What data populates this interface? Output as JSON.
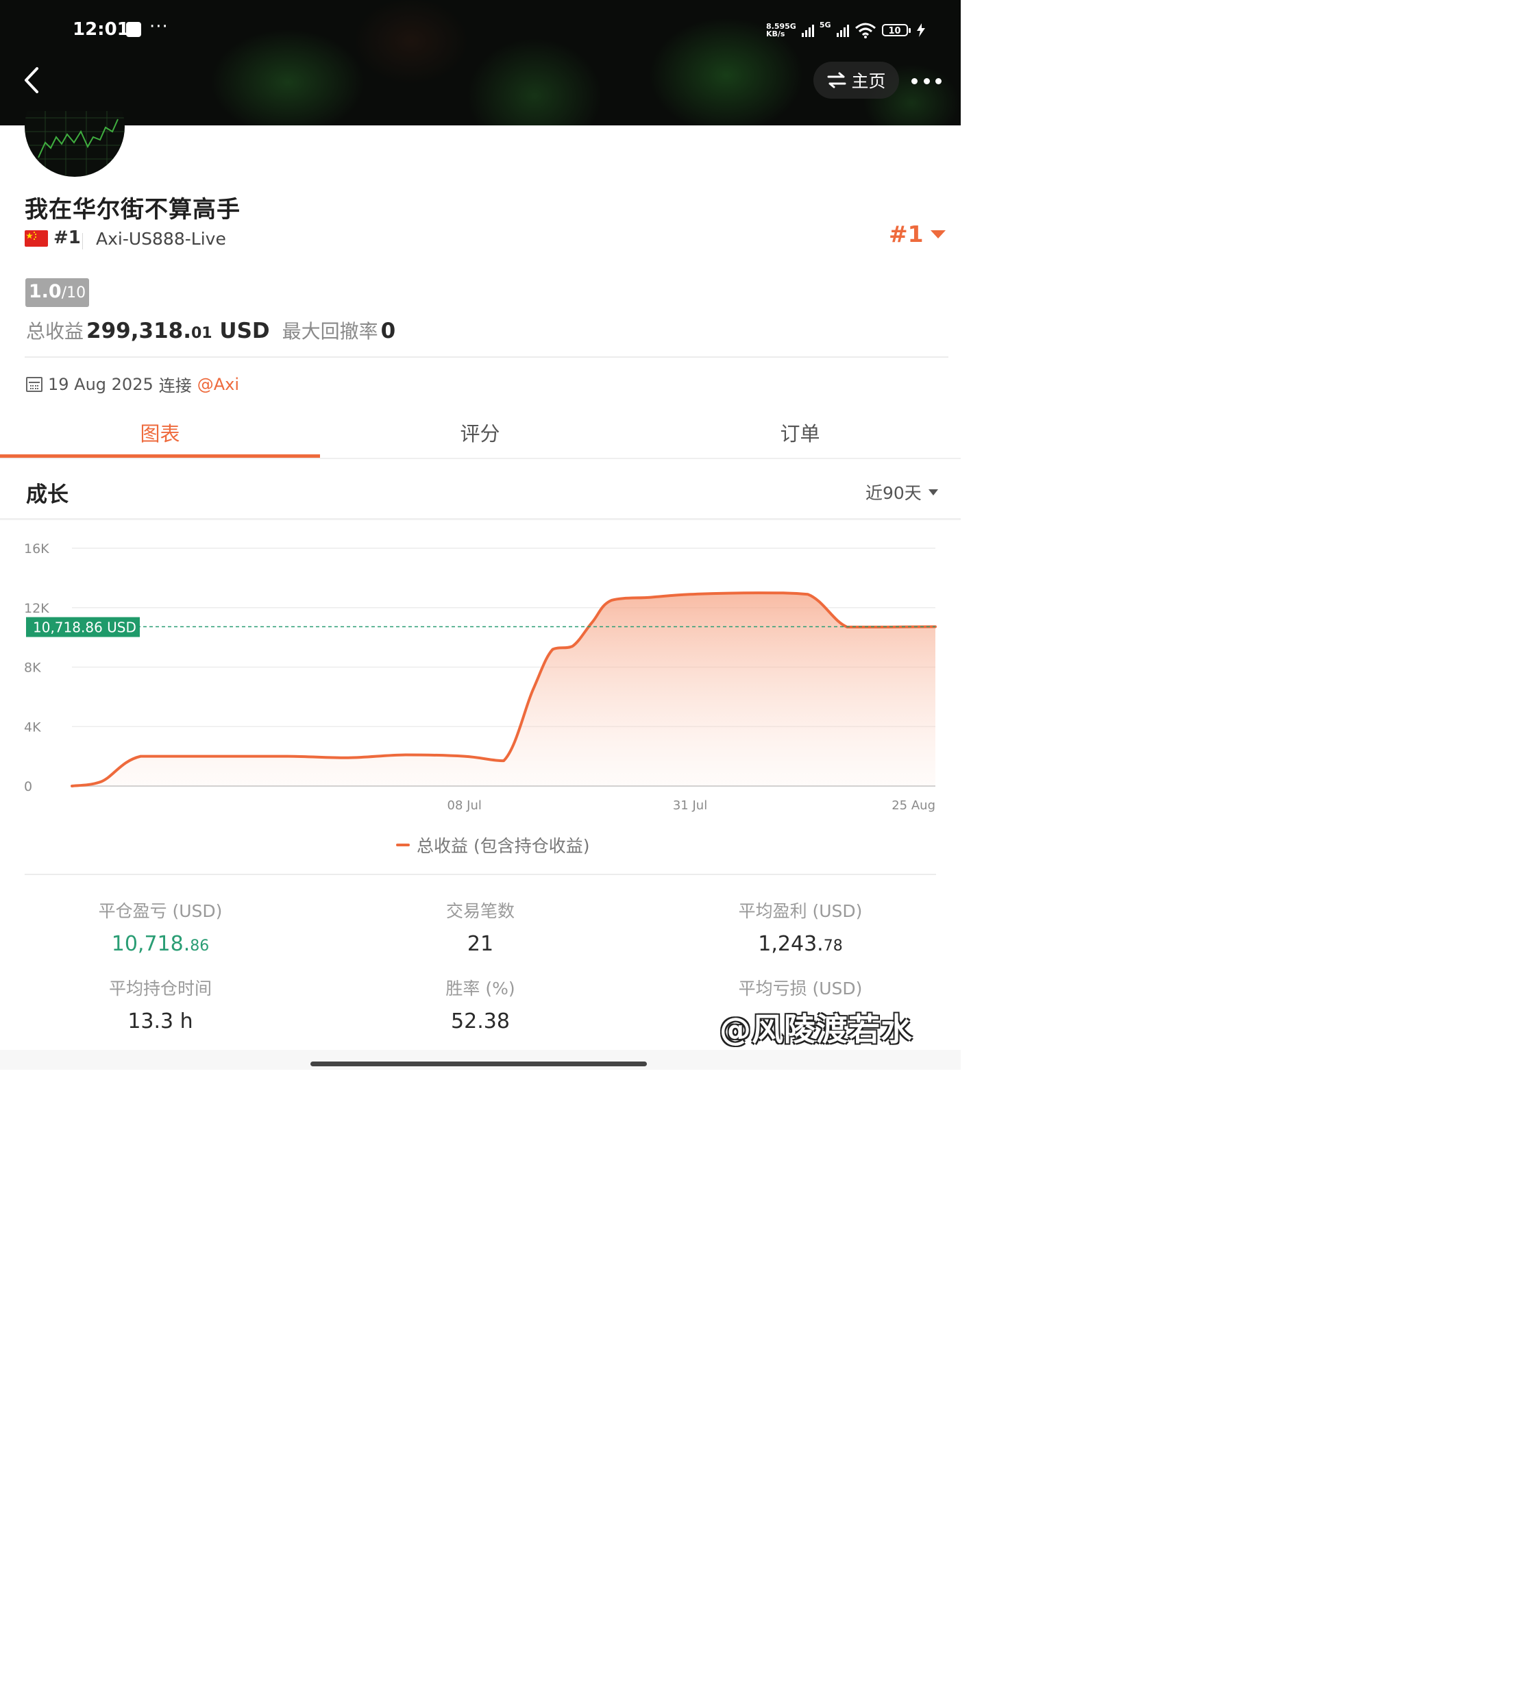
{
  "status_bar": {
    "time": "12:01",
    "net_speed_top": "8.59",
    "net_speed_bottom": "KB/s",
    "net_type_1": "5G",
    "net_type_2": "5G",
    "battery": "10"
  },
  "header": {
    "home_label": "主页"
  },
  "profile": {
    "username": "我在华尔街不算高手",
    "rank_small": "#1",
    "server": "Axi-US888-Live",
    "rank_big": "#1",
    "score": "1.0",
    "score_max": "/10",
    "total_profit_label": "总收益",
    "total_profit_int": "299,318.",
    "total_profit_dec": "01",
    "total_profit_unit": " USD",
    "max_drawdown_label": "最大回撤率",
    "max_drawdown_value": "0",
    "connect_date": "19 Aug 2025",
    "connect_label": "连接",
    "connect_broker": "@Axi"
  },
  "tabs": [
    {
      "label": "图表",
      "active": true
    },
    {
      "label": "评分",
      "active": false
    },
    {
      "label": "订单",
      "active": false
    }
  ],
  "section": {
    "title": "成长",
    "period": "近90天"
  },
  "chart_data": {
    "type": "area",
    "y_ticks": [
      "0",
      "4K",
      "8K",
      "12K",
      "16K"
    ],
    "ylim": [
      0,
      16000
    ],
    "x_tick_labels": [
      "08 Jul",
      "31 Jul",
      "25 Aug"
    ],
    "current_label": "10,718.86 USD",
    "current_value": 10718.86,
    "grid": true,
    "series": [
      {
        "name": "总收益 (包含持仓收益)",
        "x": [
          "2025-05-29",
          "2025-06-01",
          "2025-06-05",
          "2025-06-12",
          "2025-06-20",
          "2025-06-26",
          "2025-07-02",
          "2025-07-08",
          "2025-07-12",
          "2025-07-15",
          "2025-07-17",
          "2025-07-19",
          "2025-07-21",
          "2025-07-23",
          "2025-07-27",
          "2025-07-31",
          "2025-08-07",
          "2025-08-12",
          "2025-08-16",
          "2025-08-20",
          "2025-08-25"
        ],
        "y": [
          0,
          300,
          2000,
          2000,
          2000,
          1900,
          2100,
          2000,
          1700,
          6500,
          9200,
          9400,
          11000,
          12500,
          12700,
          12900,
          13000,
          12900,
          10700,
          10700,
          10719
        ]
      }
    ]
  },
  "legend": {
    "label": "总收益 (包含持仓收益)"
  },
  "stats": [
    {
      "label": "平仓盈亏 (USD)",
      "value_int": "10,718.",
      "value_dec": "86",
      "color": "#2a9d74"
    },
    {
      "label": "交易笔数",
      "value_int": "21",
      "value_dec": ""
    },
    {
      "label": "平均盈利 (USD)",
      "value_int": "1,243.",
      "value_dec": "78"
    },
    {
      "label": "平均持仓时间",
      "value_int": "13.3 h",
      "value_dec": ""
    },
    {
      "label": "胜率 (%)",
      "value_int": "52.38",
      "value_dec": ""
    },
    {
      "label": "平均亏损 (USD)",
      "value_int": "",
      "value_dec": ""
    }
  ],
  "watermark": "@风陵渡若水",
  "colors": {
    "accent": "#ee6a3c",
    "green": "#2a9d74",
    "label_green_bg": "#1f9a6a"
  }
}
